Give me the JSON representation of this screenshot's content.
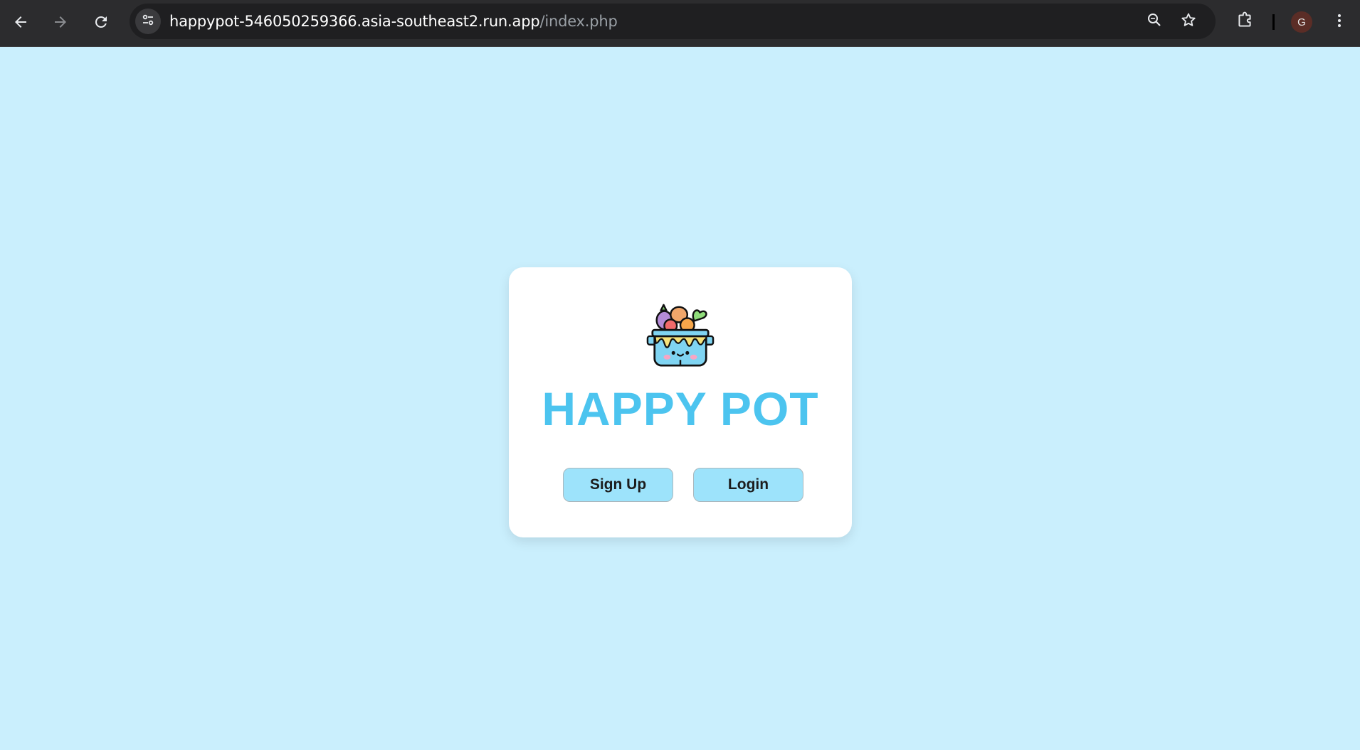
{
  "browser": {
    "url_host": "happypot-546050259366.asia-southeast2.run.app",
    "url_path": "/index.php",
    "profile_initial": "G",
    "icons": {
      "back": "arrow-left-icon",
      "forward": "arrow-right-icon",
      "reload": "reload-icon",
      "site_info": "tune-icon",
      "zoom": "zoom-icon",
      "bookmark": "star-icon",
      "extensions": "puzzle-icon",
      "menu": "kebab-menu-icon"
    },
    "colors": {
      "toolbar": "#2c2c2e",
      "omnibox": "#1f1f21",
      "avatar": "#5b2d26"
    }
  },
  "page": {
    "title": "HAPPY POT",
    "logo": "happy-pot-logo",
    "buttons": {
      "signup": "Sign Up",
      "login": "Login"
    },
    "colors": {
      "background": "#caeffd",
      "card": "#ffffff",
      "title": "#4cc4ef",
      "button": "#9de3fb"
    }
  }
}
